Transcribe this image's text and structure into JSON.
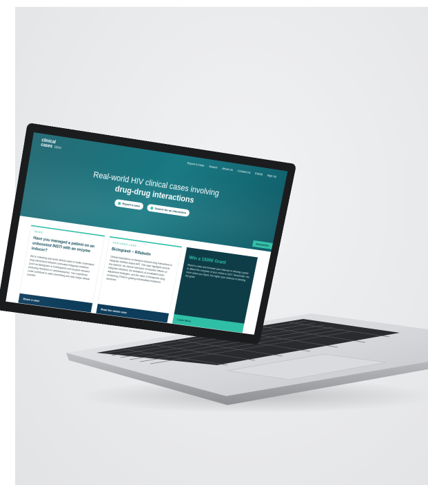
{
  "site": {
    "logo_line1": "clinical",
    "logo_line2": "cases",
    "logo_sub": "DDIs",
    "nav": [
      "Report a Case",
      "Search",
      "About Us",
      "Contact Us",
      "ENGB",
      "Sign Up"
    ],
    "hero_title_line1": "Real-world HIV clinical cases involving",
    "hero_title_line2": "drug-drug interactions",
    "hero_btn_report": "Report a case",
    "hero_btn_search": "Search for an interaction",
    "newsletter": "Newsletter"
  },
  "cards": [
    {
      "tag": "NEWS",
      "title": "Have you managed a patient on an unboosted INSTI with an enzyme inducer?",
      "body": "We're collecting real-world clinical cases to better understand drug interactions between unboosted integrase inhibitors (such as Bictegravir or Dolutegravir) and enzyme inducers (including rifampicin or carbamazepine). Your experience could contribute to safer prescribing and help shape clinical practice.",
      "footer": "Share a case"
    },
    {
      "tag": "FEATURED CASE",
      "title": "Bictegravir – Rifabutin",
      "body": "Clinical implications of rifamycin-induced drug interactions in integrase inhibitor-based ART. This case highlights several key aspects: the clinical relevance of induction effects on integrase inhibitors, the limitations of unvalidated dose-adjustment strategies, and the value of therapeutic drug monitoring (TDM) in guiding individualised treatment decisions.",
      "footer": "Read the whole case"
    },
    {
      "tag": "",
      "title": "Win a 1500€ Grant",
      "body": "Report a case and increase your chances of winning a grant to attend the congress of your choice in 2027. Remember: the more cases you report, the higher your chances of winning the grant.",
      "footer": "Learn More"
    }
  ]
}
